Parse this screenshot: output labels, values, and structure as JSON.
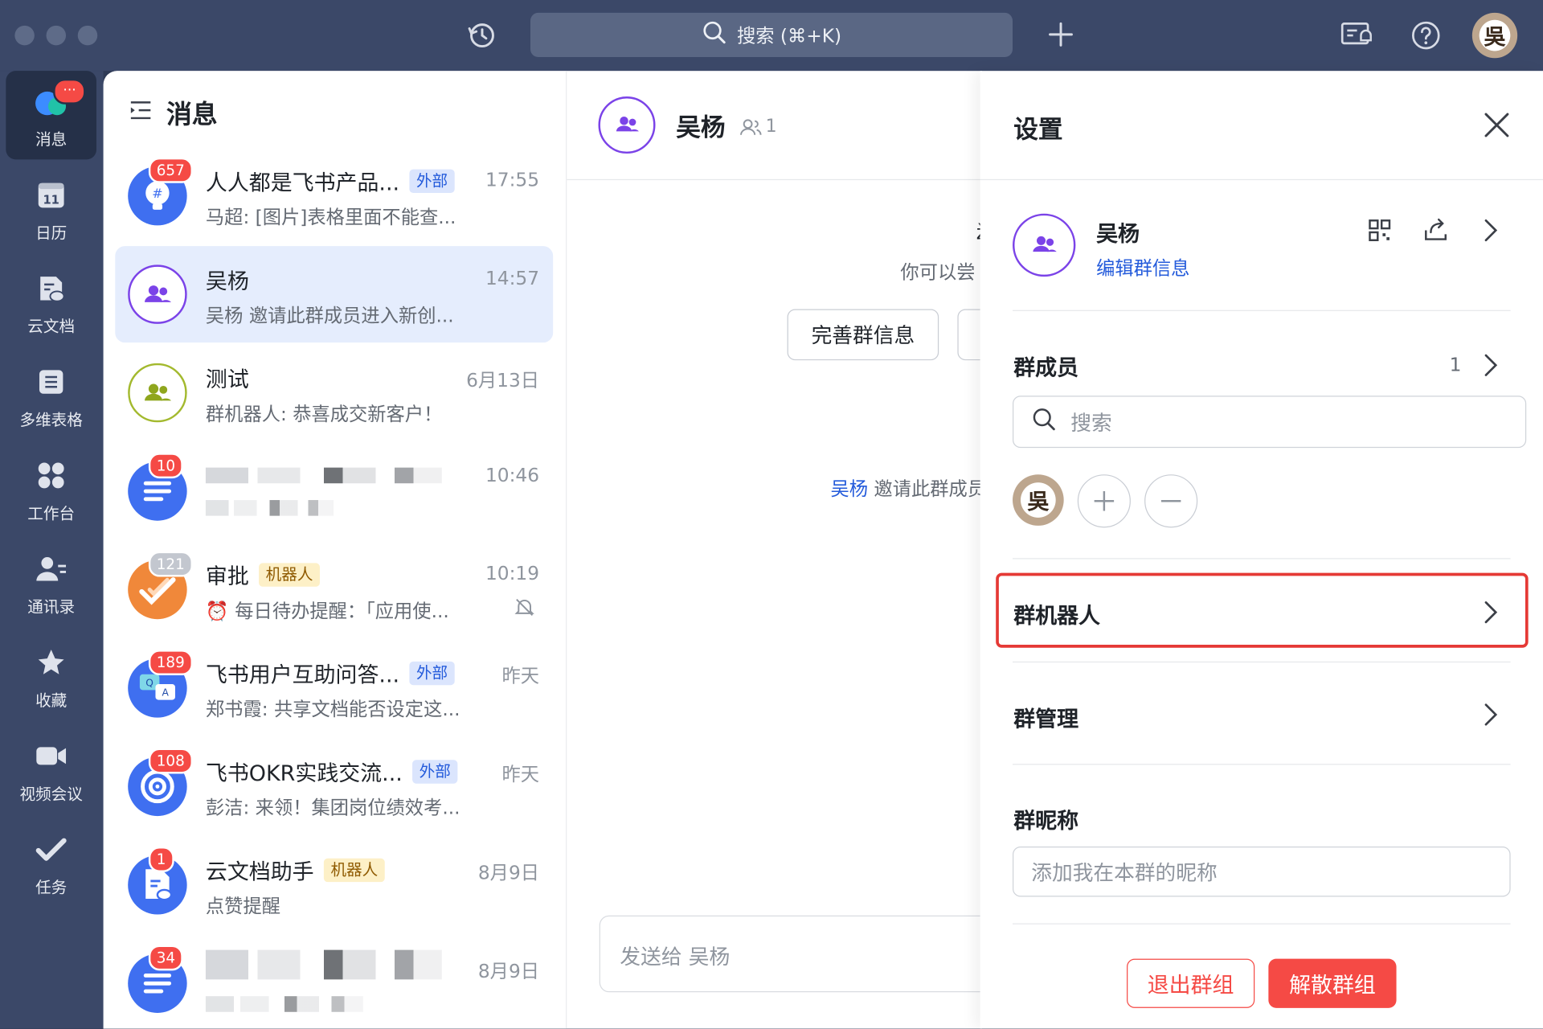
{
  "topbar": {
    "search_text": "搜索 (⌘+K)",
    "history_icon": "history-icon",
    "plus_icon": "plus-icon"
  },
  "sidebar": {
    "items": [
      {
        "label": "消息",
        "icon": "chat-bubble-icon",
        "badge": "···"
      },
      {
        "label": "日历",
        "icon": "calendar-icon",
        "day": "11"
      },
      {
        "label": "云文档",
        "icon": "cloud-doc-icon"
      },
      {
        "label": "多维表格",
        "icon": "table-icon"
      },
      {
        "label": "工作台",
        "icon": "grid-icon"
      },
      {
        "label": "通讯录",
        "icon": "contacts-icon"
      },
      {
        "label": "收藏",
        "icon": "star-icon"
      },
      {
        "label": "视频会议",
        "icon": "video-icon"
      },
      {
        "label": "任务",
        "icon": "task-icon"
      }
    ]
  },
  "message_list": {
    "title": "消息",
    "rows": [
      {
        "title": "人人都是飞书产品...",
        "tag": "外部",
        "time": "17:55",
        "preview": "马超: [图片]表格里面不能查...",
        "badge": "657"
      },
      {
        "title": "吴杨",
        "time": "14:57",
        "preview": "吴杨 邀请此群成员进入新创..."
      },
      {
        "title": "测试",
        "time": "6月13日",
        "preview": "群机器人: 恭喜成交新客户！"
      },
      {
        "time": "10:46",
        "badge": "10"
      },
      {
        "title": "审批",
        "tag": "机器人",
        "time": "10:19",
        "preview": "⏰ 每日待办提醒：「应用使...",
        "badge": "121"
      },
      {
        "title": "飞书用户互助问答...",
        "tag": "外部",
        "time": "昨天",
        "preview": "郑书霞: 共享文档能否设定这...",
        "badge": "189"
      },
      {
        "title": "飞书OKR实践交流...",
        "tag": "外部",
        "time": "昨天",
        "preview": "彭洁: 来领！集团岗位绩效考...",
        "badge": "108"
      },
      {
        "title": "云文档助手",
        "tag": "机器人",
        "time": "8月9日",
        "preview": "点赞提醒",
        "badge": "1"
      },
      {
        "time": "8月9日",
        "badge": "34"
      }
    ]
  },
  "chat": {
    "name": "吴杨",
    "member_count": "1",
    "hint_text": "你可以尝",
    "complete_btn": "完善群信息",
    "event_actor": "吴杨",
    "event_text": "邀请此群成员",
    "input_placeholder": "发送给 吴杨"
  },
  "settings": {
    "title": "设置",
    "group_name": "吴杨",
    "edit_link": "编辑群信息",
    "members_title": "群成员",
    "members_count": "1",
    "search_placeholder": "搜索",
    "member_avatar_char": "吳",
    "bots_title": "群机器人",
    "manage_title": "群管理",
    "nickname_title": "群昵称",
    "nickname_placeholder": "添加我在本群的昵称",
    "leave_btn": "退出群组",
    "dissolve_btn": "解散群组",
    "highlight_color": "#e53935"
  },
  "colors": {
    "accent": "#245bdb",
    "danger": "#f54a45",
    "group_purple": "#7b43e8"
  }
}
